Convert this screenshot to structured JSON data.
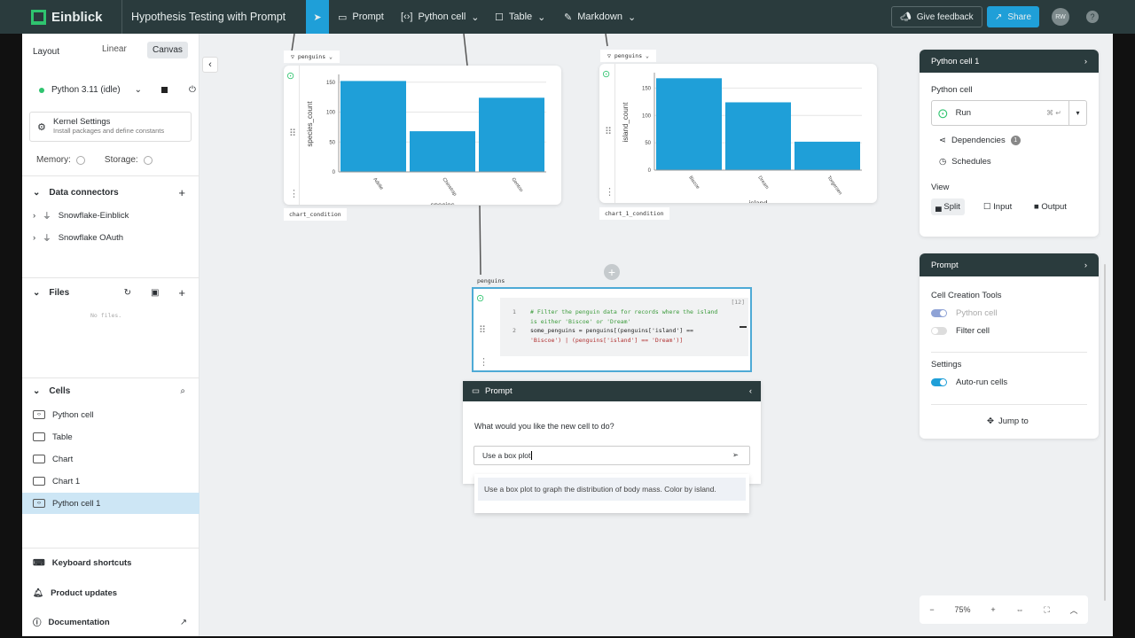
{
  "topbar": {
    "brand": "Einblick",
    "title": "Hypothesis Testing with Prompt",
    "tools": [
      "Prompt",
      "Python cell",
      "Table",
      "Markdown"
    ],
    "feedback": "Give feedback",
    "share": "Share",
    "avatar": "RW",
    "help": "?"
  },
  "sidebar": {
    "tabs": {
      "layout": "Layout",
      "linear": "Linear",
      "canvas": "Canvas"
    },
    "kernel": {
      "status": "Python 3.11 (idle)",
      "settings_title": "Kernel Settings",
      "settings_sub": "Install packages and define constants",
      "memory": "Memory:",
      "storage": "Storage:"
    },
    "data_connectors": {
      "title": "Data connectors",
      "items": [
        "Snowflake-Einblick",
        "Snowflake OAuth"
      ]
    },
    "files": {
      "title": "Files",
      "empty": "No files."
    },
    "cells": {
      "title": "Cells",
      "items": [
        "Python cell",
        "Table",
        "Chart",
        "Chart 1",
        "Python cell 1"
      ],
      "selected": "Python cell 1"
    },
    "footer": [
      "Keyboard shortcuts",
      "Product updates",
      "Documentation"
    ]
  },
  "canvas": {
    "chart1": {
      "source": "penguins",
      "condition": "chart_condition"
    },
    "chart2": {
      "source": "penguins",
      "condition": "chart_1_condition"
    },
    "code_cell": {
      "source": "penguins",
      "exec_count": "[12]",
      "lines": [
        {
          "n": "1",
          "text": "# Filter the penguin data for records where the island",
          "cont": "is either 'Biscoe' or 'Dream'"
        },
        {
          "n": "2",
          "text": "some_penguins = penguins[(penguins['island'] ==",
          "cont": "'Biscoe') | (penguins['island'] == 'Dream')]"
        }
      ]
    },
    "prompt": {
      "title": "Prompt",
      "question": "What would you like the new cell to do?",
      "input": "Use a box plot",
      "suggestion": "Use a box plot to graph the distribution of body mass. Color by island."
    }
  },
  "chart_data": [
    {
      "type": "bar",
      "categories": [
        "Adelie",
        "Chinstrap",
        "Gentoo"
      ],
      "values": [
        152,
        68,
        124
      ],
      "xlabel": "species",
      "ylabel": "species_count",
      "ylim": [
        0,
        160
      ],
      "ticks": [
        0,
        50,
        100,
        150
      ],
      "color": "#1f9fd8"
    },
    {
      "type": "bar",
      "categories": [
        "Biscoe",
        "Dream",
        "Torgersen"
      ],
      "values": [
        168,
        124,
        52
      ],
      "xlabel": "island",
      "ylabel": "island_count",
      "ylim": [
        0,
        175
      ],
      "ticks": [
        0,
        50,
        100,
        150
      ],
      "color": "#1f9fd8"
    }
  ],
  "right": {
    "cell_panel": {
      "title": "Python cell 1",
      "type": "Python cell",
      "run": "Run",
      "shortcut": "⌘ ↵",
      "dependencies": "Dependencies",
      "dep_count": "1",
      "schedules": "Schedules",
      "view": "View",
      "views": [
        "Split",
        "Input",
        "Output"
      ]
    },
    "prompt_panel": {
      "title": "Prompt",
      "tools_title": "Cell Creation Tools",
      "tools": [
        "Python cell",
        "Filter cell"
      ],
      "settings": "Settings",
      "autorun": "Auto-run cells",
      "jump": "Jump to"
    }
  },
  "zoom": {
    "level": "75%"
  }
}
